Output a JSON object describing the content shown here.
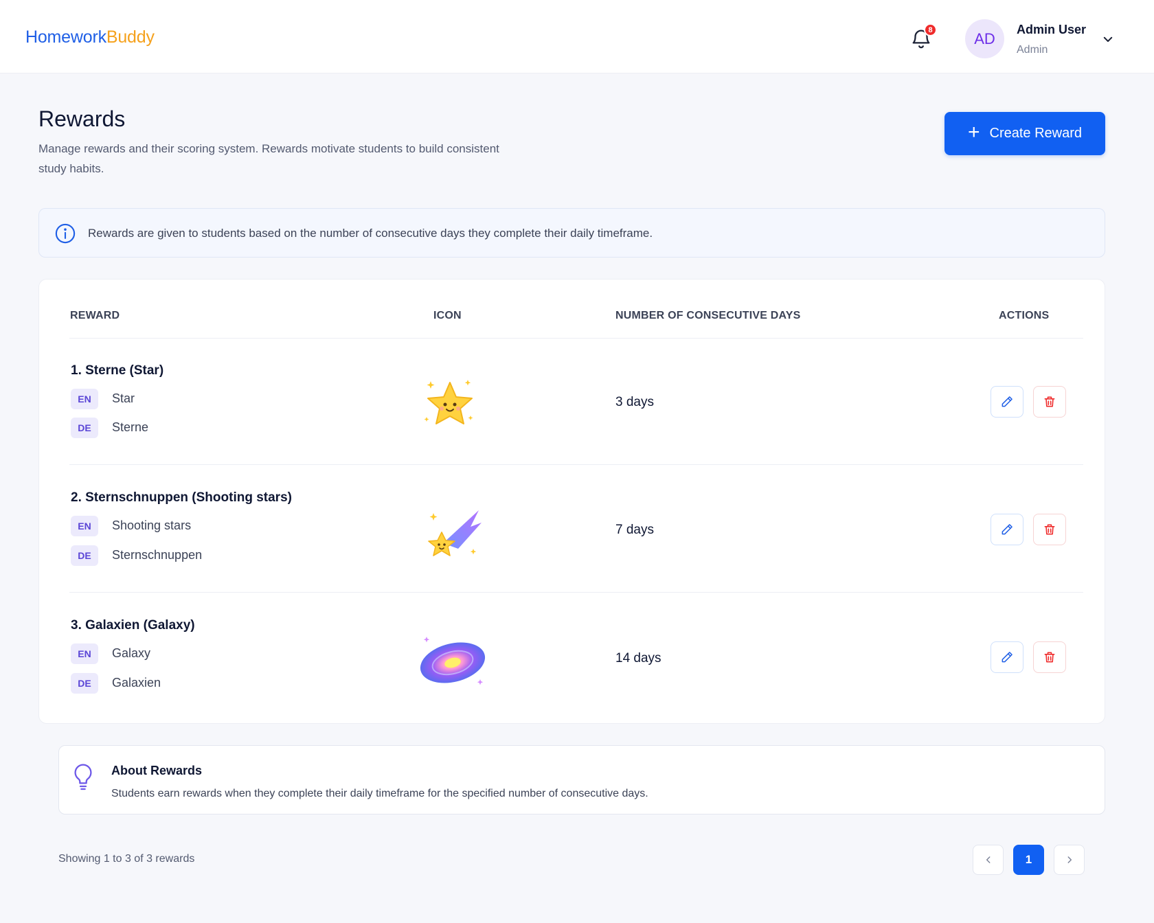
{
  "header": {
    "logo_part1": "Homework",
    "logo_part2": "Buddy",
    "notification_count": "8",
    "user": {
      "initials": "AD",
      "name": "Admin User",
      "role": "Admin"
    }
  },
  "page": {
    "title": "Rewards",
    "description": "Manage rewards and their scoring system. Rewards motivate students to build consistent study habits.",
    "create_button_label": "Create Reward"
  },
  "info_banner": {
    "text": "Rewards are given to students based on the number of consecutive days they complete their daily timeframe."
  },
  "table": {
    "columns": [
      "REWARD",
      "ICON",
      "NUMBER OF CONSECUTIVE DAYS",
      "ACTIONS"
    ],
    "rows": [
      {
        "title": "1.  Sterne (Star)",
        "lang1_code": "EN",
        "lang1_value": "Star",
        "lang2_code": "DE",
        "lang2_value": "Sterne",
        "icon": "star-icon",
        "days": "3 days"
      },
      {
        "title": "2.  Sternschnuppen (Shooting stars)",
        "lang1_code": "EN",
        "lang1_value": "Shooting stars",
        "lang2_code": "DE",
        "lang2_value": "Sternschnuppen",
        "icon": "shooting-star-icon",
        "days": "7 days"
      },
      {
        "title": "3.  Galaxien (Galaxy)",
        "lang1_code": "EN",
        "lang1_value": "Galaxy",
        "lang2_code": "DE",
        "lang2_value": "Galaxien",
        "icon": "galaxy-icon",
        "days": "14 days"
      }
    ]
  },
  "about": {
    "title": "About Rewards",
    "text": "Students earn rewards when they complete their daily timeframe for the specified number of consecutive days."
  },
  "pagination": {
    "summary": "Showing 1 to 3 of 3 rewards",
    "current_page": "1"
  },
  "colors": {
    "primary": "#1160f2",
    "logo_blue": "#1f5fe6",
    "logo_orange": "#f5a11c",
    "danger": "#ef2b2b",
    "chip_bg": "#eceafc",
    "chip_text": "#5a45d6"
  }
}
